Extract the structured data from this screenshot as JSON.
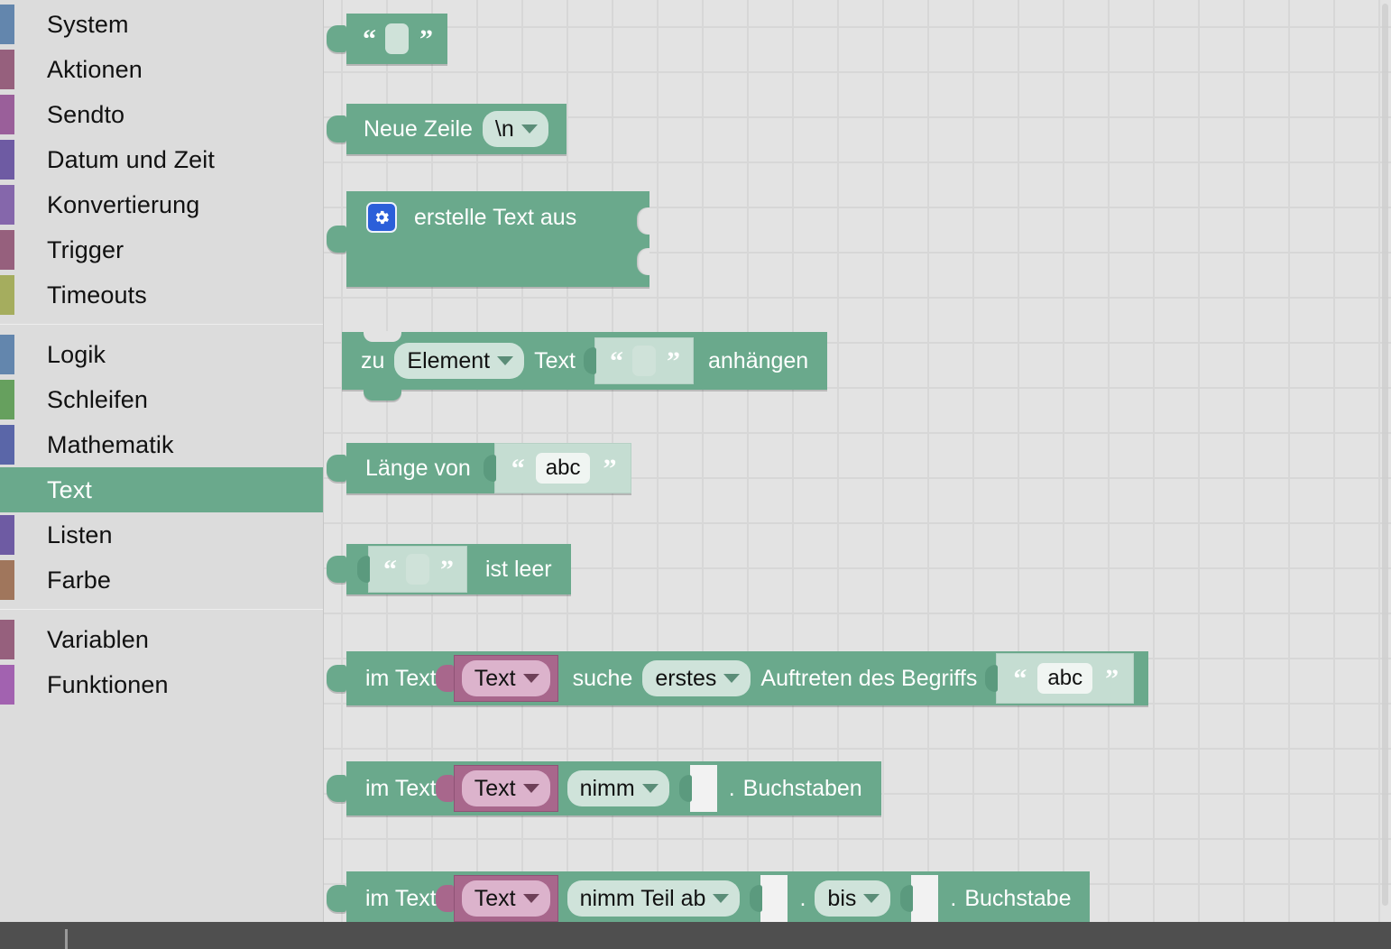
{
  "app": {
    "title": "Blockly Text Blocks Toolbox",
    "colors": {
      "workspace_bg": "#e3e3e3",
      "toolbox_bg": "#dcdcdc",
      "text_category_accent": "#6aa98c",
      "variable_block": "#a8678c",
      "mutator_icon": "#2b5fd9"
    }
  },
  "toolbox": {
    "groups": [
      {
        "items": [
          {
            "label": "System",
            "swatch": "#6386ad",
            "selected": false
          },
          {
            "label": "Aktionen",
            "swatch": "#96607d",
            "selected": false
          },
          {
            "label": "Sendto",
            "swatch": "#9a5f9a",
            "selected": false
          },
          {
            "label": "Datum und Zeit",
            "swatch": "#6e5ba3",
            "selected": false
          },
          {
            "label": "Konvertierung",
            "swatch": "#8567ab",
            "selected": false
          },
          {
            "label": "Trigger",
            "swatch": "#96607d",
            "selected": false
          },
          {
            "label": "Timeouts",
            "swatch": "#a5ad5e",
            "selected": false
          }
        ]
      },
      {
        "items": [
          {
            "label": "Logik",
            "swatch": "#6386ad",
            "selected": false
          },
          {
            "label": "Schleifen",
            "swatch": "#66a05e",
            "selected": false
          },
          {
            "label": "Mathematik",
            "swatch": "#5a66a8",
            "selected": false
          },
          {
            "label": "Text",
            "swatch": "#6aa98c",
            "selected": true
          },
          {
            "label": "Listen",
            "swatch": "#6e5ba3",
            "selected": false
          },
          {
            "label": "Farbe",
            "swatch": "#a0765c",
            "selected": false
          }
        ]
      },
      {
        "items": [
          {
            "label": "Variablen",
            "swatch": "#96607d",
            "selected": false
          },
          {
            "label": "Funktionen",
            "swatch": "#a262b0",
            "selected": false
          }
        ]
      }
    ]
  },
  "blocks": {
    "text_string": {
      "name": "text-string-block",
      "quote_open": "“",
      "quote_close": "”",
      "value": ""
    },
    "newline": {
      "name": "text-newline-block",
      "label": "Neue Zeile",
      "dropdown_value": "\\n"
    },
    "create_text": {
      "name": "text-join-block",
      "label": "erstelle Text aus",
      "mutator_icon": "gear-icon"
    },
    "append": {
      "name": "text-append-block",
      "prefix": "zu",
      "variable_dropdown": "Element",
      "middle": "Text",
      "quote_open": "“",
      "quote_close": "”",
      "value": "",
      "suffix": "anhängen"
    },
    "length": {
      "name": "text-length-block",
      "label": "Länge von",
      "quote_open": "“",
      "quote_close": "”",
      "value": "abc"
    },
    "is_empty": {
      "name": "text-is-empty-block",
      "quote_open": "“",
      "quote_close": "”",
      "value": "",
      "label": "ist leer"
    },
    "index_of": {
      "name": "text-index-of-block",
      "prefix": "im Text",
      "variable_dropdown": "Text",
      "mid1": "suche",
      "which_dropdown": "erstes",
      "mid2": "Auftreten des Begriffs",
      "quote_open": "“",
      "quote_close": "”",
      "value": "abc"
    },
    "char_at": {
      "name": "text-char-at-block",
      "prefix": "im Text",
      "variable_dropdown": "Text",
      "mode_dropdown": "nimm",
      "number_value": "",
      "dot": ".",
      "suffix": "Buchstaben"
    },
    "get_substring": {
      "name": "text-get-substring-block",
      "prefix": "im Text",
      "variable_dropdown": "Text",
      "mode_dropdown": "nimm Teil ab",
      "start_value": "",
      "dot1": ".",
      "to_dropdown": "bis",
      "end_value": "",
      "dot2": ".",
      "suffix": "Buchstabe"
    }
  }
}
